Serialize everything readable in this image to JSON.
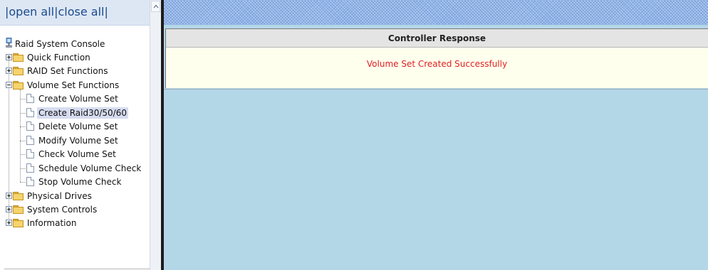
{
  "toolbar": {
    "bar1": "|",
    "open_all": "open all",
    "bar2": "|",
    "close_all": "close all",
    "bar3": "|"
  },
  "tree": {
    "root": "Raid System Console",
    "quick_function": "Quick Function",
    "raid_set_functions": "RAID Set Functions",
    "volume_set_functions": "Volume Set Functions",
    "volume_children": [
      "Create Volume Set",
      "Create Raid30/50/60",
      "Delete Volume Set",
      "Modify Volume Set",
      "Check Volume Set",
      "Schedule Volume Check",
      "Stop Volume Check"
    ],
    "selected": "Create Raid30/50/60",
    "physical_drives": "Physical Drives",
    "system_controls": "System Controls",
    "information": "Information"
  },
  "response": {
    "header": "Controller Response",
    "message": "Volume Set Created Successfully",
    "message_color": "#e02020"
  },
  "icons": {
    "root": "network-computer-icon",
    "folder": "folder-icon",
    "page": "document-icon",
    "expand": "expand-plus-icon",
    "collapse": "collapse-minus-icon"
  }
}
